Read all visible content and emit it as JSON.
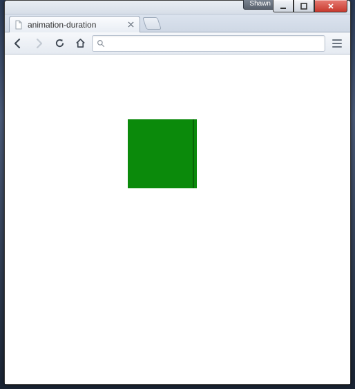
{
  "frame": {
    "user_badge": "Shawn"
  },
  "tabs": [
    {
      "title": "animation-duration"
    }
  ],
  "omnibox": {
    "value": "",
    "placeholder": ""
  },
  "content": {
    "demo_box_color": "#0b8a0b"
  }
}
